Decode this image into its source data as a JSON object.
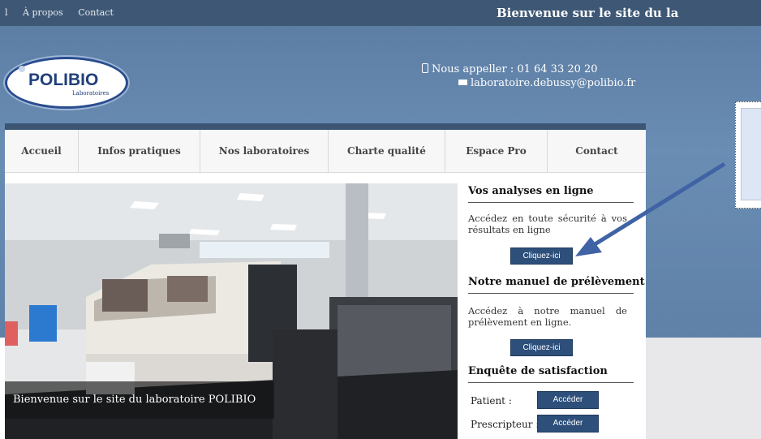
{
  "topbar": {
    "link1": "l",
    "link2": "À propos",
    "link3": "Contact",
    "welcome": "Bienvenue sur le site du la"
  },
  "brand": {
    "name": "POLIBIO",
    "sub": "Laboratoires"
  },
  "contact": {
    "phone": "Nous appeller : 01 64 33 20 20",
    "email": "laboratoire.debussy@polibio.fr"
  },
  "nav": [
    {
      "label": "Accueil"
    },
    {
      "label": "Infos pratiques"
    },
    {
      "label": "Nos laboratoires"
    },
    {
      "label": "Charte qualité"
    },
    {
      "label": "Espace Pro"
    },
    {
      "label": "Contact"
    }
  ],
  "hero": {
    "caption": "Bienvenue sur le site du laboratoire POLIBIO"
  },
  "sidebar": {
    "analyses_title": "Vos analyses en ligne",
    "analyses_text": "Accédez en toute sécurité à vos résultats en ligne",
    "analyses_button": "Cliquez-ici",
    "manuel_title": "Notre manuel de prélèvement",
    "manuel_text": "Accédez à notre manuel de prélèvement en ligne.",
    "manuel_button": "Cliquez-ici",
    "enquete_title": "Enquête de satisfaction",
    "patient_label": "Patient :",
    "patient_button": "Accéder",
    "prescripteur_label": "Prescripteur :",
    "prescripteur_button": "Accéder"
  },
  "annotation": {
    "arrow_color": "#3f63a4"
  }
}
